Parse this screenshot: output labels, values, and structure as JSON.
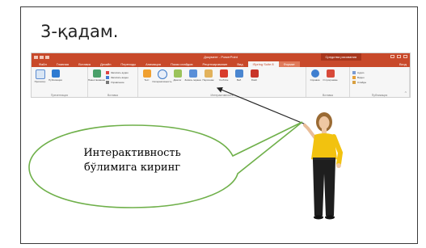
{
  "slide": {
    "title": "3-қадам.",
    "callout_line1": "Интерактивность",
    "callout_line2": "бўлимига киринг"
  },
  "ribbon": {
    "window_title": "Документ - PowerPoint",
    "tools_label": "Средства рисования",
    "signin": "Вход",
    "tabs": [
      {
        "label": "Файл"
      },
      {
        "label": "Главная"
      },
      {
        "label": "Вставка"
      },
      {
        "label": "Дизайн"
      },
      {
        "label": "Переходы"
      },
      {
        "label": "Анимация"
      },
      {
        "label": "Показ слайдов"
      },
      {
        "label": "Рецензирование"
      },
      {
        "label": "Вид"
      },
      {
        "label": "iSpring Suite 8"
      },
      {
        "label": "Формат"
      }
    ],
    "groups": {
      "presentation": "Презентация",
      "insert": "Вставка",
      "interactivity": "Интерактивность",
      "insert2": "Вставка",
      "publish": "Публикация"
    },
    "commands": {
      "preview": "Просмотр",
      "publish": "Публикация",
      "narration": "Повествование",
      "record_audio": "Записать аудио",
      "record_video": "Записать видео",
      "manage": "Управление",
      "quiz": "Тест",
      "interaction": "Интерактивность",
      "dialog": "Диалог",
      "screen_recording": "Запись экрана",
      "character": "Персонаж",
      "youtube": "YouTube",
      "web": "Веб",
      "flash": "Flash",
      "help": "Справка",
      "about": "О программе",
      "audio": "Аудио",
      "video": "Видео",
      "slides": "Слайды",
      "references": "Ссылки"
    }
  },
  "colors": {
    "accent": "#c8492a",
    "callout_border": "#6fb04a"
  }
}
